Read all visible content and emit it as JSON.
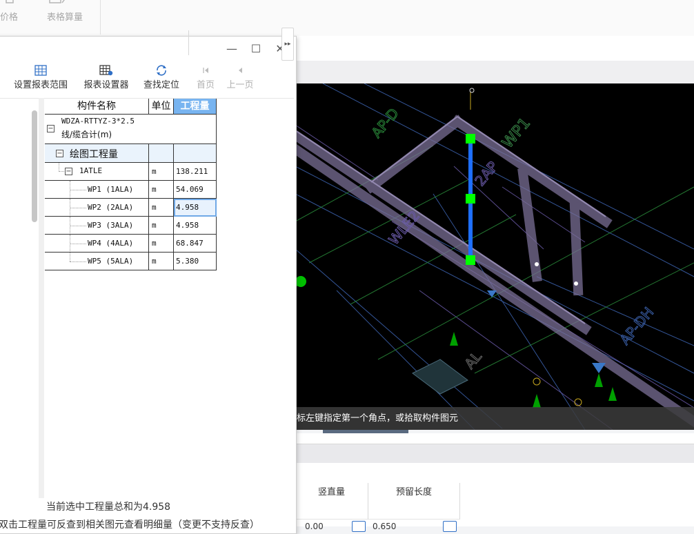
{
  "ribbon": {
    "item1_label": "价格",
    "item2_label": "表格算量"
  },
  "dialog": {
    "toolbar": [
      {
        "label": "设置报表范围",
        "icon": "grid-icon"
      },
      {
        "label": "报表设置器",
        "icon": "grid-settings-icon"
      },
      {
        "label": "查找定位",
        "icon": "refresh-locate-icon"
      },
      {
        "label": "首页",
        "icon": "first-page-icon",
        "disabled": true
      },
      {
        "label": "上一页",
        "icon": "prev-page-icon",
        "disabled": true
      }
    ],
    "window_buttons": {
      "minimize": "—",
      "maximize": "☐",
      "close": "✕"
    },
    "table": {
      "headers": [
        "构件名称",
        "单位",
        "工程量"
      ],
      "group_line1": "WDZA-RTTYZ-3*2.5",
      "group_line2": "线/缆合计(m)",
      "subgroup": "绘图工程量",
      "parent": {
        "name": "1ATLE",
        "unit": "m",
        "value": "138.211"
      },
      "rows": [
        {
          "name": "WP1 (1ALA)",
          "unit": "m",
          "value": "54.069"
        },
        {
          "name": "WP2 (2ALA)",
          "unit": "m",
          "value": "4.958"
        },
        {
          "name": "WP3 (3ALA)",
          "unit": "m",
          "value": "4.958"
        },
        {
          "name": "WP4 (4ALA)",
          "unit": "m",
          "value": "68.847"
        },
        {
          "name": "WP5 (5ALA)",
          "unit": "m",
          "value": "5.380"
        }
      ]
    },
    "status_sum": "当前选中工程量总和为4.958",
    "status_tip": "双击工程量可反查到相关图元查看明细量（变更不支持反查）"
  },
  "viewport": {
    "hint": "标左键指定第一个角点，或拾取构件图元",
    "labels": [
      "WP1",
      "2AP",
      "AP-D",
      "WLE2",
      "AP-DH",
      "AL"
    ]
  },
  "bottom_table": {
    "headers": [
      "竖直量",
      "预留长度"
    ],
    "values": [
      "0.00",
      "0.650"
    ]
  },
  "colors": {
    "accent": "#78b4f0",
    "selection_bar": "#1e6fff",
    "grip": "#00ff00",
    "viewport_bg": "#000000"
  }
}
